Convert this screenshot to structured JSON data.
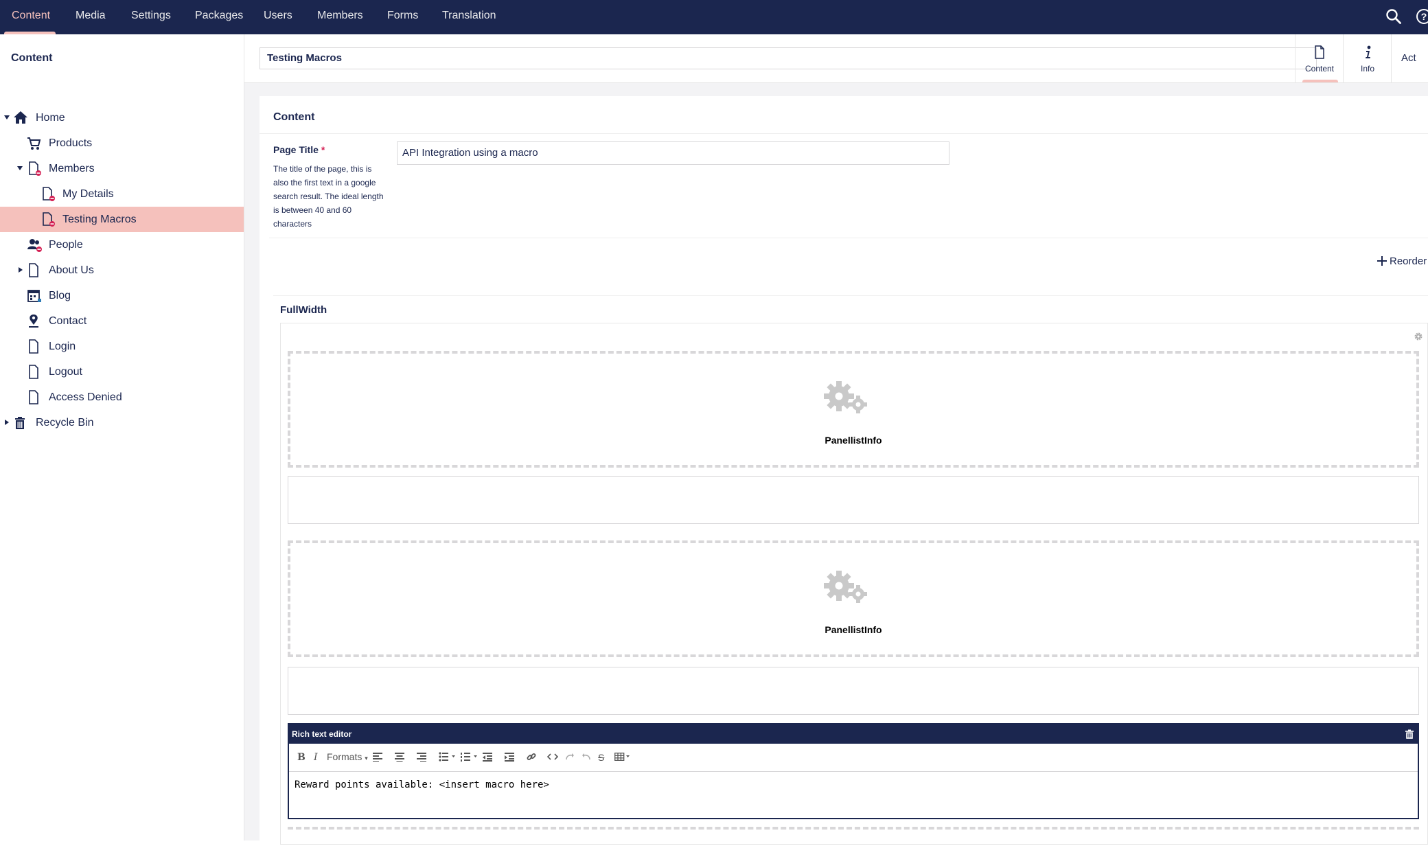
{
  "top_nav": {
    "items": [
      {
        "label": "Content",
        "active": true
      },
      {
        "label": "Media",
        "active": false
      },
      {
        "label": "Settings",
        "active": false
      },
      {
        "label": "Packages",
        "active": false
      },
      {
        "label": "Users",
        "active": false
      },
      {
        "label": "Members",
        "active": false
      },
      {
        "label": "Forms",
        "active": false
      },
      {
        "label": "Translation",
        "active": false
      }
    ],
    "icons": [
      "search-icon",
      "help-icon"
    ]
  },
  "sidebar": {
    "title": "Content",
    "tree": [
      {
        "label": "Home",
        "icon": "home-icon",
        "expanded": true
      },
      {
        "label": "Products",
        "icon": "cart-icon"
      },
      {
        "label": "Members",
        "icon": "document-restricted-icon",
        "expanded": true
      },
      {
        "label": "My Details",
        "icon": "document-restricted-icon"
      },
      {
        "label": "Testing Macros",
        "icon": "document-restricted-icon",
        "selected": true
      },
      {
        "label": "People",
        "icon": "people-icon"
      },
      {
        "label": "About Us",
        "icon": "document-icon",
        "expanded": false
      },
      {
        "label": "Blog",
        "icon": "calendar-icon"
      },
      {
        "label": "Contact",
        "icon": "map-marker-icon"
      },
      {
        "label": "Login",
        "icon": "document-icon"
      },
      {
        "label": "Logout",
        "icon": "document-icon"
      },
      {
        "label": "Access Denied",
        "icon": "document-icon"
      },
      {
        "label": "Recycle Bin",
        "icon": "trash-icon",
        "expanded": false
      }
    ]
  },
  "editor": {
    "node_name": "Testing Macros",
    "apps": [
      {
        "label": "Content",
        "icon": "document-icon",
        "active": true
      },
      {
        "label": "Info",
        "icon": "info-icon",
        "active": false
      },
      {
        "label": "Act",
        "icon": "actions-icon",
        "active": false
      }
    ],
    "group_title": "Content",
    "page_title": {
      "label": "Page Title",
      "required_mark": "*",
      "description": "The title of the page, this is also the first text in a google search result. The ideal length is between 40 and 60 characters",
      "value": "API Integration using a macro"
    },
    "reorder_label": "Reorder",
    "grid": {
      "section_title": "FullWidth",
      "macros": [
        {
          "label": "PanellistInfo",
          "icon": "gears-icon"
        },
        {
          "label": "PanellistInfo",
          "icon": "gears-icon"
        }
      ],
      "rte": {
        "title": "Rich text editor",
        "formats_label": "Formats",
        "body": "Reward points available: <insert macro here>"
      }
    }
  },
  "colors": {
    "navy": "#1b264f",
    "accent_pink": "#f5c1bc",
    "required_red": "#d42054"
  }
}
